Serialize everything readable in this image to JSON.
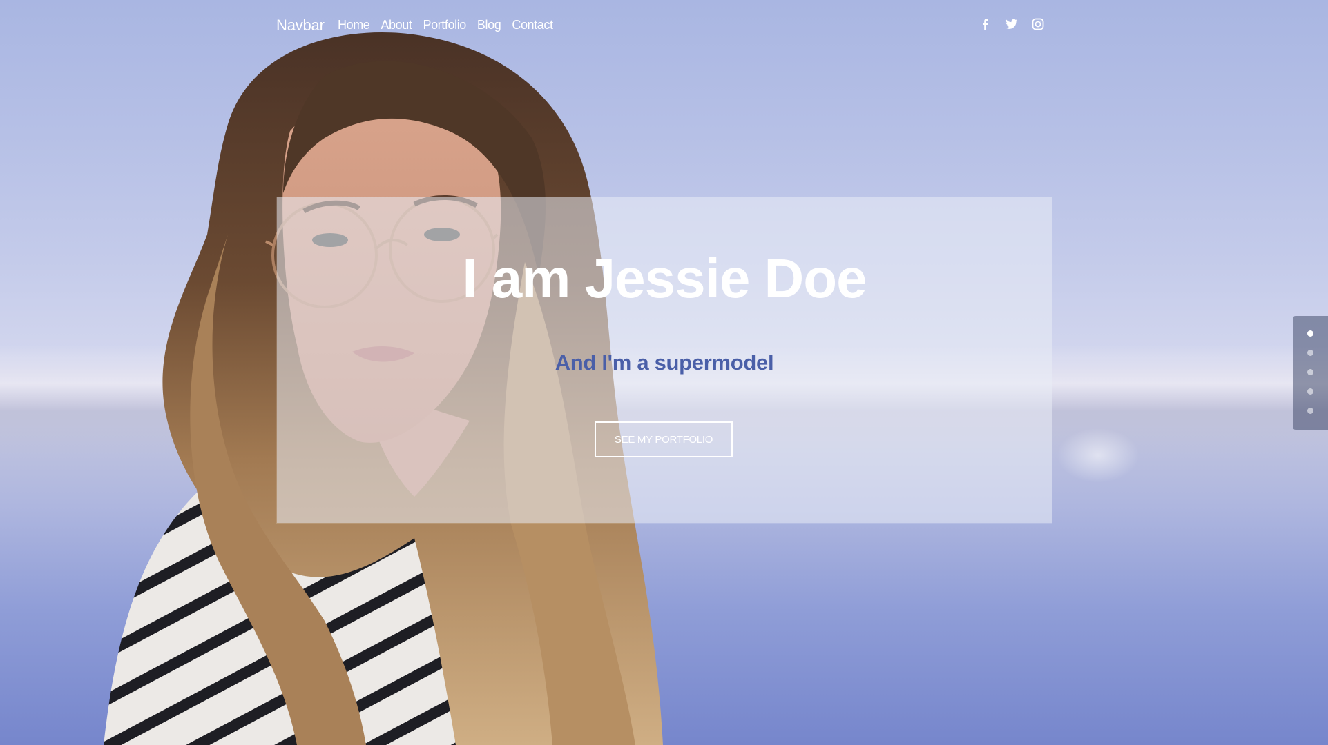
{
  "navbar": {
    "brand": "Navbar",
    "links": [
      {
        "label": "Home"
      },
      {
        "label": "About"
      },
      {
        "label": "Portfolio"
      },
      {
        "label": "Blog"
      },
      {
        "label": "Contact"
      }
    ],
    "social": [
      {
        "icon": "facebook-icon"
      },
      {
        "icon": "twitter-icon"
      },
      {
        "icon": "instagram-icon"
      }
    ]
  },
  "hero": {
    "title": "I am Jessie Doe",
    "subtitle": "And I'm a supermodel",
    "button_label": "SEE MY PORTFOLIO"
  },
  "slide_nav": {
    "count": 5,
    "active_index": 0
  },
  "colors": {
    "subtitle": "#4a5fa8",
    "card_overlay": "#e9ecf6",
    "background_top": "#a9b6e2",
    "background_bottom": "#7686cc"
  }
}
